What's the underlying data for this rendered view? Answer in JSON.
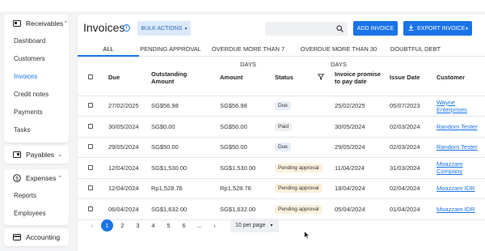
{
  "sidebar": {
    "receivables": {
      "label": "Receivables",
      "items": [
        {
          "label": "Dashboard"
        },
        {
          "label": "Customers"
        },
        {
          "label": "Invoices"
        },
        {
          "label": "Credit notes"
        },
        {
          "label": "Payments"
        },
        {
          "label": "Tasks"
        }
      ]
    },
    "payables": {
      "label": "Payables"
    },
    "expenses": {
      "label": "Expenses",
      "items": [
        {
          "label": "Reports"
        },
        {
          "label": "Employees"
        }
      ]
    },
    "accounting": {
      "label": "Accounting"
    }
  },
  "header": {
    "title": "Invoices",
    "bulk_actions": "BULK ACTIONS",
    "search_placeholder": "",
    "add_invoice": "ADD INVOICE",
    "export_invoice": "EXPORT INVOICE"
  },
  "tabs": [
    {
      "label": "ALL"
    },
    {
      "label": "PENDING APPROVAL"
    },
    {
      "label": "OVERDUE MORE THAN 7 DAYS"
    },
    {
      "label": "OVERDUE MORE THAN 30 DAYS"
    },
    {
      "label": "DOUBTFUL DEBT"
    }
  ],
  "table": {
    "columns": {
      "due": "Due",
      "outstanding": "Outstanding Amount",
      "amount": "Amount",
      "status": "Status",
      "promise": "Invoice promise to pay date",
      "issue": "Issue Date",
      "customer": "Customer"
    },
    "rows": [
      {
        "due": "27/02/2025",
        "outstanding": "SG$56.98",
        "amount": "SG$56.98",
        "status": "Due",
        "promise": "25/02/2025",
        "issue": "05/07/2023",
        "customer": "Wayne Enterprises"
      },
      {
        "due": "30/05/2024",
        "outstanding": "SG$0.00",
        "amount": "SG$50.00",
        "status": "Paid",
        "promise": "30/05/2024",
        "issue": "02/03/2024",
        "customer": "Random Tester"
      },
      {
        "due": "29/05/2024",
        "outstanding": "SG$50.00",
        "amount": "SG$50.00",
        "status": "Due",
        "promise": "29/05/2024",
        "issue": "02/03/2024",
        "customer": "Random Tester"
      },
      {
        "due": "12/04/2024",
        "outstanding": "SG$1,530.00",
        "amount": "SG$1,530.00",
        "status": "Pending approval",
        "promise": "11/04/2024",
        "issue": "31/03/2024",
        "customer": "Moazzam Company"
      },
      {
        "due": "12/04/2024",
        "outstanding": "Rp1,528.76",
        "amount": "Rp1,528.76",
        "status": "Pending approval",
        "promise": "18/04/2024",
        "issue": "02/04/2024",
        "customer": "Moazzam IDR"
      },
      {
        "due": "06/04/2024",
        "outstanding": "SG$1,632.00",
        "amount": "SG$1,632.00",
        "status": "Pending approval",
        "promise": "05/04/2024",
        "issue": "01/04/2024",
        "customer": "Moazzam IDR"
      }
    ]
  },
  "pagination": {
    "prev": "‹",
    "pages": [
      "1",
      "2",
      "3",
      "4",
      "5",
      "6",
      "...",
      "›"
    ],
    "current": "1",
    "per_page": "10 per page"
  },
  "colors": {
    "accent": "#1a73e8",
    "active_nav": "#1a73e8",
    "pending_badge": "#fbf0dc"
  }
}
